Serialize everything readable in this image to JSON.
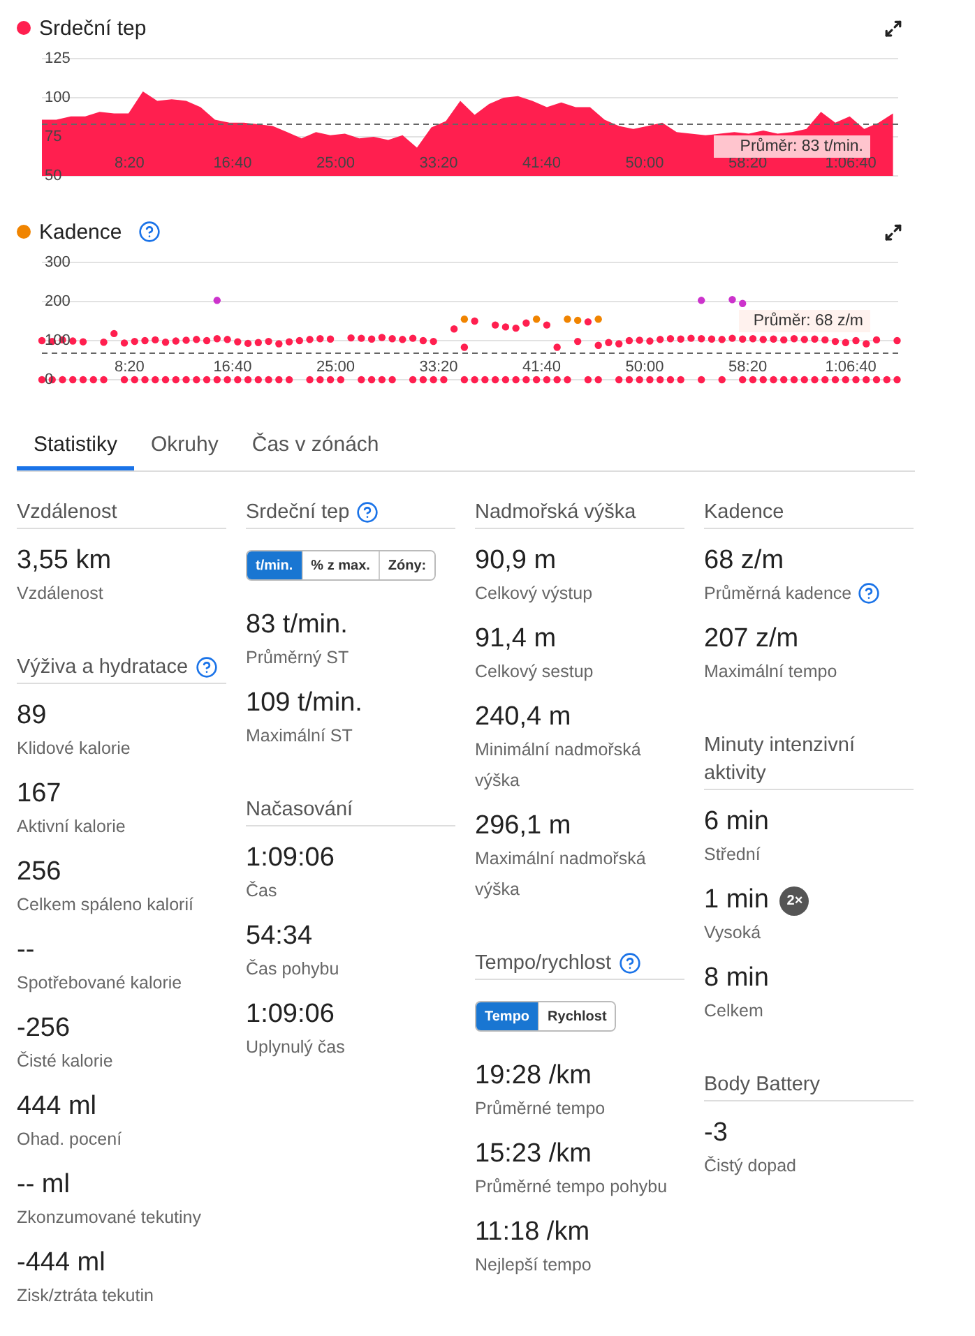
{
  "charts": [
    {
      "color": "#ff1f4f",
      "chart_data": {
        "type": "area",
        "title": "Srdeční tep",
        "xlim": [
          75,
          4230
        ],
        "ylim": [
          50,
          125
        ],
        "yticks": [
          125,
          100,
          75,
          50
        ],
        "xticks": [
          {
            "value": 500,
            "label": "8:20"
          },
          {
            "value": 1000,
            "label": "16:40"
          },
          {
            "value": 1500,
            "label": "25:00"
          },
          {
            "value": 2000,
            "label": "33:20"
          },
          {
            "value": 2500,
            "label": "41:40"
          },
          {
            "value": 3000,
            "label": "50:00"
          },
          {
            "value": 3500,
            "label": "58:20"
          },
          {
            "value": 4000,
            "label": "1:06:40"
          }
        ],
        "x": [
          75,
          145,
          215,
          285,
          355,
          425,
          495,
          565,
          635,
          705,
          775,
          845,
          915,
          985,
          1055,
          1125,
          1195,
          1265,
          1335,
          1405,
          1475,
          1545,
          1615,
          1685,
          1755,
          1825,
          1895,
          1965,
          2035,
          2105,
          2175,
          2245,
          2315,
          2385,
          2455,
          2525,
          2595,
          2665,
          2735,
          2805,
          2875,
          2945,
          3015,
          3085,
          3155,
          3225,
          3295,
          3365,
          3435,
          3505,
          3575,
          3645,
          3715,
          3785,
          3855,
          3925,
          3995,
          4065,
          4135,
          4205
        ],
        "series": [
          {
            "color": "#ff1f4f",
            "values": [
              86,
              86,
              88,
              88,
              91,
              90,
              90,
              104,
              98,
              99,
              98,
              94,
              86,
              84,
              84,
              83,
              82,
              78,
              74,
              78,
              76,
              77,
              74,
              75,
              73,
              76,
              68,
              81,
              85,
              98,
              89,
              96,
              100,
              101,
              98,
              94,
              97,
              94,
              94,
              86,
              82,
              80,
              82,
              84,
              78,
              77,
              76,
              77,
              78,
              77,
              79,
              77,
              78,
              80,
              91,
              84,
              88,
              80,
              84,
              90
            ]
          }
        ],
        "ref_lines": [
          {
            "axis": "y",
            "value": 83,
            "label": "Průměr: 83 t/min."
          }
        ]
      }
    },
    {
      "color": "#f08400",
      "help": true,
      "chart_data": {
        "type": "scatter",
        "title": "Kadence",
        "xlim": [
          75,
          4230
        ],
        "ylim": [
          0,
          300
        ],
        "yticks": [
          300,
          200,
          100,
          0
        ],
        "xticks": [
          {
            "value": 500,
            "label": "8:20"
          },
          {
            "value": 1000,
            "label": "16:40"
          },
          {
            "value": 1500,
            "label": "25:00"
          },
          {
            "value": 2000,
            "label": "33:20"
          },
          {
            "value": 2500,
            "label": "41:40"
          },
          {
            "value": 3000,
            "label": "50:00"
          },
          {
            "value": 3500,
            "label": "58:20"
          },
          {
            "value": 4000,
            "label": "1:06:40"
          }
        ],
        "x": [
          75,
          125,
          175,
          225,
          275,
          325,
          375,
          425,
          475,
          525,
          575,
          625,
          675,
          725,
          775,
          825,
          875,
          925,
          975,
          1025,
          1075,
          1125,
          1175,
          1225,
          1275,
          1325,
          1375,
          1425,
          1475,
          1525,
          1575,
          1625,
          1675,
          1725,
          1775,
          1825,
          1875,
          1925,
          1975,
          2025,
          2075,
          2125,
          2175,
          2225,
          2275,
          2325,
          2375,
          2425,
          2475,
          2525,
          2575,
          2625,
          2675,
          2725,
          2775,
          2825,
          2875,
          2925,
          2975,
          3025,
          3075,
          3125,
          3175,
          3225,
          3275,
          3325,
          3375,
          3425,
          3475,
          3525,
          3575,
          3625,
          3675,
          3725,
          3775,
          3825,
          3875,
          3925,
          3975,
          4025,
          4075,
          4125,
          4175,
          4225
        ],
        "series": [
          {
            "color": "#ff1f4f",
            "values": [
              100,
              98,
              102,
              99,
              97,
              null,
              96,
              118,
              94,
              98,
              100,
              102,
              96,
              99,
              101,
              103,
              100,
              105,
              103,
              97,
              93,
              95,
              98,
              92,
              97,
              100,
              103,
              105,
              104,
              null,
              107,
              106,
              104,
              108,
              105,
              103,
              106,
              100,
              98,
              null,
              130,
              83,
              150,
              null,
              140,
              135,
              132,
              145,
              null,
              140,
              83,
              null,
              98,
              148,
              88,
              95,
              92,
              100,
              101,
              99,
              103,
              105,
              104,
              106,
              105,
              104,
              103,
              106,
              104,
              105,
              103,
              104,
              102,
              105,
              103,
              104,
              102,
              98,
              95,
              100,
              92,
              102,
              null,
              100
            ]
          },
          {
            "color": "#ff1f4f",
            "values": [
              0,
              0,
              0,
              0,
              0,
              0,
              0,
              null,
              0,
              0,
              0,
              0,
              0,
              0,
              0,
              0,
              0,
              0,
              0,
              0,
              0,
              0,
              0,
              0,
              0,
              null,
              0,
              0,
              0,
              0,
              null,
              0,
              0,
              0,
              0,
              null,
              0,
              0,
              0,
              0,
              null,
              0,
              0,
              0,
              0,
              0,
              0,
              0,
              0,
              0,
              0,
              0,
              null,
              0,
              0,
              null,
              0,
              0,
              0,
              0,
              0,
              0,
              0,
              null,
              0,
              null,
              0,
              null,
              0,
              0,
              0,
              0,
              0,
              0,
              0,
              0,
              0,
              0,
              0,
              0,
              0,
              0,
              0,
              0
            ]
          },
          {
            "color": "#f08400",
            "x": [
              2125,
              2475,
              2625,
              2675,
              2775
            ],
            "values": [
              155,
              155,
              155,
              152,
              155
            ]
          },
          {
            "color": "#cc33cc",
            "x": [
              925,
              3275,
              3425,
              3475
            ],
            "values": [
              203,
              203,
              205,
              195
            ]
          }
        ],
        "ref_lines": [
          {
            "axis": "y",
            "value": 68,
            "label": "Průměr: 68 z/m"
          }
        ]
      }
    }
  ],
  "tabs": [
    {
      "label": "Statistiky",
      "selected": true
    },
    {
      "label": "Okruhy",
      "selected": false
    },
    {
      "label": "Čas v zónách",
      "selected": false
    }
  ],
  "columns": [
    {
      "sections": [
        {
          "title": "Vzdálenost",
          "items": [
            {
              "kind": "stat",
              "value": "3,55 km",
              "label": "Vzdálenost"
            }
          ]
        },
        {
          "title": "Výživa a hydratace",
          "help": true,
          "items": [
            {
              "kind": "stat",
              "value": "89",
              "label": "Klidové kalorie"
            },
            {
              "kind": "stat",
              "value": "167",
              "label": "Aktivní kalorie"
            },
            {
              "kind": "stat",
              "value": "256",
              "label": "Celkem spáleno kalorií"
            },
            {
              "kind": "stat",
              "value": "--",
              "label": "Spotřebované kalorie"
            },
            {
              "kind": "stat",
              "value": "-256",
              "label": "Čisté kalorie"
            },
            {
              "kind": "stat",
              "value": "444 ml",
              "label": "Ohad. pocení"
            },
            {
              "kind": "stat",
              "value": "-- ml",
              "label": "Zkonzumované tekutiny"
            },
            {
              "kind": "stat",
              "value": "-444 ml",
              "label": "Zisk/ztráta tekutin"
            }
          ]
        }
      ]
    },
    {
      "sections": [
        {
          "title": "Srdeční tep",
          "help": true,
          "items": [
            {
              "kind": "toggle",
              "options": [
                {
                  "label": "t/min.",
                  "selected": true
                },
                {
                  "label": "% z max.",
                  "selected": false
                },
                {
                  "label": "Zóny:",
                  "selected": false
                }
              ]
            },
            {
              "kind": "stat",
              "value": "83 t/min.",
              "label": "Průměrný ST"
            },
            {
              "kind": "stat",
              "value": "109 t/min.",
              "label": "Maximální ST"
            }
          ]
        },
        {
          "title": "Načasování",
          "items": [
            {
              "kind": "stat",
              "value": "1:09:06",
              "label": "Čas"
            },
            {
              "kind": "stat",
              "value": "54:34",
              "label": "Čas pohybu"
            },
            {
              "kind": "stat",
              "value": "1:09:06",
              "label": "Uplynulý čas"
            }
          ]
        }
      ]
    },
    {
      "sections": [
        {
          "title": "Nadmořská výška",
          "items": [
            {
              "kind": "stat",
              "value": "90,9 m",
              "label": "Celkový výstup"
            },
            {
              "kind": "stat",
              "value": "91,4 m",
              "label": "Celkový sestup"
            },
            {
              "kind": "stat",
              "value": "240,4 m",
              "label": "Minimální nadmořská výška"
            },
            {
              "kind": "stat",
              "value": "296,1 m",
              "label": "Maximální nadmořská výška"
            }
          ]
        },
        {
          "title": "Tempo/rychlost",
          "help": true,
          "items": [
            {
              "kind": "toggle",
              "options": [
                {
                  "label": "Tempo",
                  "selected": true
                },
                {
                  "label": "Rychlost",
                  "selected": false
                }
              ]
            },
            {
              "kind": "stat",
              "value": "19:28 /km",
              "label": "Průměrné tempo"
            },
            {
              "kind": "stat",
              "value": "15:23 /km",
              "label": "Průměrné tempo pohybu"
            },
            {
              "kind": "stat",
              "value": "11:18 /km",
              "label": "Nejlepší tempo"
            }
          ]
        }
      ]
    },
    {
      "sections": [
        {
          "title": "Kadence",
          "items": [
            {
              "kind": "stat",
              "value": "68 z/m",
              "label": "Průměrná kadence",
              "help": true
            },
            {
              "kind": "stat",
              "value": "207 z/m",
              "label": "Maximální tempo"
            }
          ]
        },
        {
          "title": "Minuty intenzivní aktivity",
          "items": [
            {
              "kind": "stat",
              "value": "6 min",
              "label": "Střední"
            },
            {
              "kind": "stat",
              "value": "1 min",
              "label": "Vysoká",
              "badge": "2×"
            },
            {
              "kind": "stat",
              "value": "8 min",
              "label": "Celkem"
            }
          ]
        },
        {
          "title": "Body Battery",
          "items": [
            {
              "kind": "stat",
              "value": "-3",
              "label": "Čistý dopad"
            }
          ]
        }
      ]
    }
  ]
}
